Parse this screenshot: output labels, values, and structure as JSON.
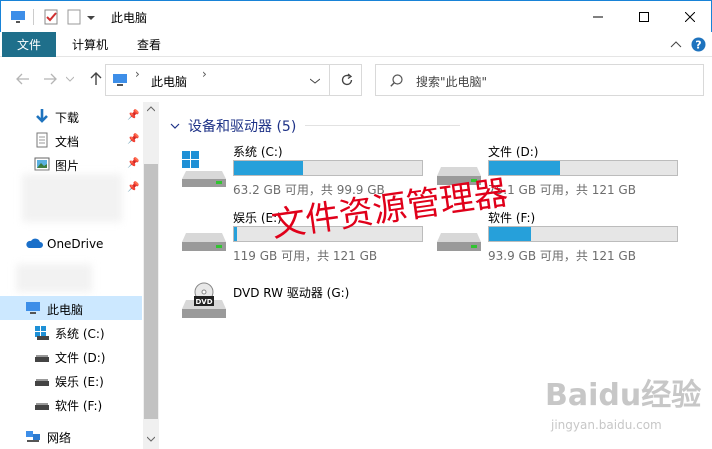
{
  "window": {
    "title": "此电脑",
    "controls": [
      "minimize-icon",
      "maximize-icon",
      "close-icon"
    ]
  },
  "ribbon": {
    "tabs": [
      {
        "label": "文件"
      },
      {
        "label": "计算机"
      },
      {
        "label": "查看"
      }
    ]
  },
  "address": {
    "path": "此电脑",
    "search_placeholder": "搜索\"此电脑\""
  },
  "sidebar": {
    "quick_access": [
      {
        "label": "下载",
        "icon": "download-arrow-icon"
      },
      {
        "label": "文档",
        "icon": "document-icon"
      },
      {
        "label": "图片",
        "icon": "picture-icon"
      }
    ],
    "onedrive": "OneDrive",
    "this_pc": "此电脑",
    "drives": [
      {
        "label": "系统 (C:)"
      },
      {
        "label": "文件 (D:)"
      },
      {
        "label": "娱乐 (E:)"
      },
      {
        "label": "软件 (F:)"
      }
    ],
    "network": "网络"
  },
  "main": {
    "group_title": "设备和驱动器 (5)",
    "drives": [
      {
        "name": "系统 (C:)",
        "free": "63.2 GB 可用，共 99.9 GB",
        "used_fraction": 0.367
      },
      {
        "name": "文件 (D:)",
        "free": "75.1 GB 可用，共 121 GB",
        "used_fraction": 0.379
      },
      {
        "name": "娱乐 (E:)",
        "free": "119 GB 可用，共 121 GB",
        "used_fraction": 0.017
      },
      {
        "name": "软件 (F:)",
        "free": "93.9 GB 可用，共 121 GB",
        "used_fraction": 0.224
      },
      {
        "name": "DVD RW 驱动器 (G:)"
      }
    ]
  },
  "overlay_text": "文件资源管理器",
  "watermark": {
    "main": "Baidu经验",
    "sub": "jingyan.baidu.com"
  },
  "colors": {
    "accent": "#1f6f8b",
    "progress": "#26a0da",
    "selection": "#cce8ff",
    "overlay": "#e0001a"
  }
}
